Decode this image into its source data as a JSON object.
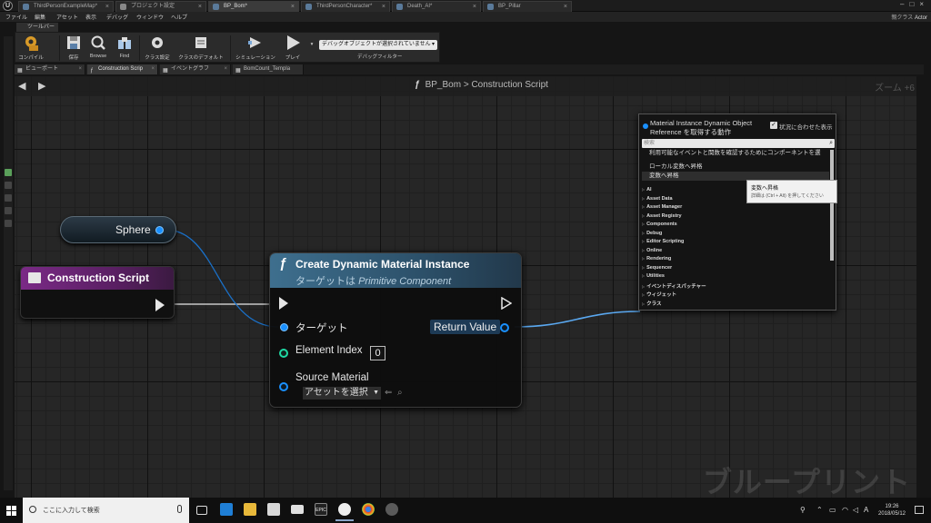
{
  "titlebar": {
    "tabs": [
      {
        "label": "ThirdPersonExampleMap*"
      },
      {
        "label": "プロジェクト設定"
      },
      {
        "label": "BP_Bom*"
      },
      {
        "label": "ThirdPersonCharacter*"
      },
      {
        "label": "Death_AI*"
      },
      {
        "label": "BP_Pillar"
      }
    ],
    "parent_class_label": "親クラス",
    "parent_class_value": "Actor"
  },
  "menubar": {
    "items": [
      "ファイル",
      "編集",
      "アセット",
      "表示",
      "デバッグ",
      "ウィンドウ",
      "ヘルプ"
    ]
  },
  "toolbar": {
    "tab_label": "ツールバー",
    "buttons": [
      "コンパイル",
      "保存",
      "Browse",
      "Find",
      "クラス設定",
      "クラスのデフォルト",
      "シミュレーション",
      "プレイ"
    ],
    "debug_dropdown": "デバッグオブジェクトが選択されていません",
    "debug_filter_label": "デバッグフィルター"
  },
  "editor_tabs": [
    {
      "label": "ビューポート"
    },
    {
      "label": "Construction Scrip"
    },
    {
      "label": "イベントグラフ"
    },
    {
      "label": "BomCount_Templa"
    }
  ],
  "graph": {
    "breadcrumb_bp": "BP_Bom",
    "breadcrumb_sep": ">",
    "breadcrumb_graph": "Construction Script",
    "zoom": "ズーム +6",
    "watermark": "ブループリント"
  },
  "nodes": {
    "sphere": {
      "label": "Sphere"
    },
    "construction_script": {
      "title": "Construction Script"
    },
    "cdmi": {
      "title": "Create Dynamic Material Instance",
      "target_prefix": "ターゲットは",
      "target_class": "Primitive Component",
      "pin_target": "ターゲット",
      "pin_return": "Return Value",
      "pin_element_index": "Element Index",
      "element_index_value": "0",
      "pin_source_material": "Source Material",
      "asset_select": "アセットを選択"
    }
  },
  "context_menu": {
    "title": "Material Instance Dynamic Object Reference を取得する動作",
    "context_sensitive_label": "状況に合わせた表示",
    "search_placeholder": "検索",
    "rows": [
      "利用可能なイベントと関数を確認するためにコンポーネントを選",
      "ローカル変数へ昇格",
      "変数へ昇格"
    ],
    "categories": [
      "AI",
      "Asset Data",
      "Asset Manager",
      "Asset Registry",
      "Components",
      "Debug",
      "Editor Scripting",
      "Online",
      "Rendering",
      "Sequencer",
      "Utilities",
      "イベントディスパッチャー",
      "ウィジェット",
      "クラス"
    ]
  },
  "tooltip": {
    "title": "変数へ昇格",
    "detail": "詳細は (Ctrl + Alt) を押してください"
  },
  "taskbar": {
    "search_text": "ここに入力して検索",
    "epic_label": "EPIC",
    "ime_label": "A",
    "time": "19:26",
    "date": "2018/05/12"
  }
}
